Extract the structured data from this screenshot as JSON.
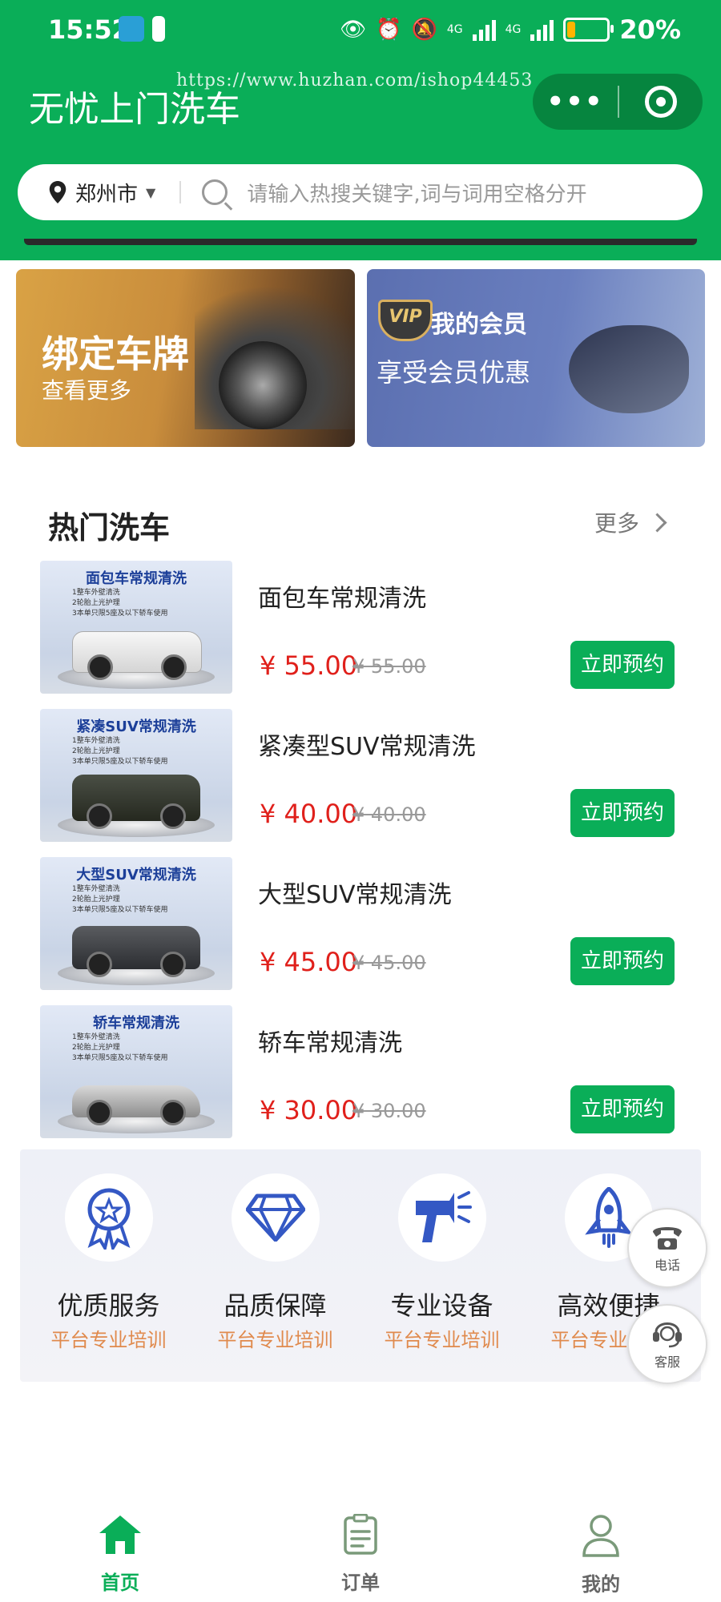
{
  "status_bar": {
    "time": "15:52",
    "network_1": "4G",
    "network_2": "4G",
    "battery_pct": "20%"
  },
  "header": {
    "app_title": "无忧上门洗车",
    "watermark": "https://www.huzhan.com/ishop44453",
    "capsule_more": "•••"
  },
  "search": {
    "city": "郑州市",
    "placeholder": "请输入热搜关键字,词与词用空格分开"
  },
  "promos": {
    "left": {
      "title": "绑定车牌",
      "subtitle": "查看更多"
    },
    "right": {
      "badge": "VIP",
      "title": "我的会员",
      "subtitle": "享受会员优惠"
    }
  },
  "section": {
    "title": "热门洗车",
    "more": "更多"
  },
  "items": [
    {
      "name": "面包车常规清洗",
      "price": "¥ 55.00",
      "old_price": "¥ 55.00",
      "button": "立即预约",
      "thumb_title": "面包车常规清洗",
      "thumb_lines": [
        "1整车外壁清洗",
        "2轮胎上光护理",
        "3本单只限5座及以下轿车使用"
      ]
    },
    {
      "name": "紧凑型SUV常规清洗",
      "price": "¥ 40.00",
      "old_price": "¥ 40.00",
      "button": "立即预约",
      "thumb_title": "紧凑SUV常规清洗",
      "thumb_lines": [
        "1整车外壁清洗",
        "2轮胎上光护理",
        "3本单只限5座及以下轿车使用"
      ]
    },
    {
      "name": "大型SUV常规清洗",
      "price": "¥ 45.00",
      "old_price": "¥ 45.00",
      "button": "立即预约",
      "thumb_title": "大型SUV常规清洗",
      "thumb_lines": [
        "1整车外壁清洗",
        "2轮胎上光护理",
        "3本单只限5座及以下轿车使用"
      ]
    },
    {
      "name": "轿车常规清洗",
      "price": "¥ 30.00",
      "old_price": "¥ 30.00",
      "button": "立即预约",
      "thumb_title": "轿车常规清洗",
      "thumb_lines": [
        "1整车外壁清洗",
        "2轮胎上光护理",
        "3本单只限5座及以下轿车使用"
      ]
    }
  ],
  "features": [
    {
      "title": "优质服务",
      "subtitle": "平台专业培训",
      "icon": "award-badge-icon"
    },
    {
      "title": "品质保障",
      "subtitle": "平台专业培训",
      "icon": "diamond-icon"
    },
    {
      "title": "专业设备",
      "subtitle": "平台专业培训",
      "icon": "spray-gun-icon"
    },
    {
      "title": "高效便捷",
      "subtitle": "平台专业培训",
      "icon": "rocket-icon"
    }
  ],
  "float_buttons": {
    "phone": "电话",
    "service": "客服"
  },
  "tabbar": [
    {
      "label": "首页",
      "icon": "home-icon",
      "active": true
    },
    {
      "label": "订单",
      "icon": "order-icon",
      "active": false
    },
    {
      "label": "我的",
      "icon": "user-icon",
      "active": false
    }
  ],
  "colors": {
    "brand_green": "#0aae58",
    "price_red": "#e0201b",
    "feature_orange": "#e08a4d",
    "icon_blue": "#3458c4"
  }
}
